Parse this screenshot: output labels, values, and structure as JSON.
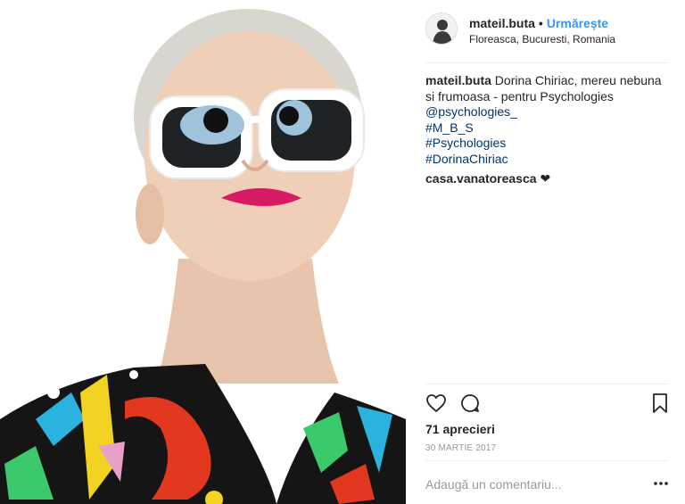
{
  "post": {
    "username": "mateil.buta",
    "dot": "•",
    "follow_label": "Urmărește",
    "location": "Floreasca, Bucuresti, Romania"
  },
  "caption": {
    "username": "mateil.buta",
    "text": "Dorina Chiriac, mereu nebuna si frumoasa - pentru Psychologies",
    "tags": [
      "@psychologies_",
      "#M_B_S",
      "#Psychologies",
      "#DorinaChiriac"
    ]
  },
  "comments": [
    {
      "username": "casa.vanatoreasca",
      "text": "❤"
    }
  ],
  "actions": {
    "like_icon": "heart-outline-icon",
    "comment_icon": "speech-bubble-icon",
    "save_icon": "bookmark-icon"
  },
  "likes": "71 aprecieri",
  "date": "30 MARTIE 2017",
  "add_comment_placeholder": "Adaugă un comentariu...",
  "colors": {
    "accent_follow": "#3897f0",
    "hashtag": "#003569",
    "muted": "#999999",
    "divider": "#efefef"
  }
}
